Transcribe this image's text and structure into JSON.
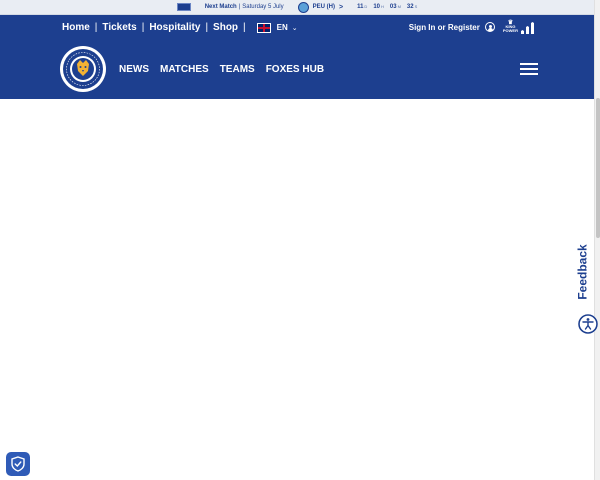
{
  "match_bar": {
    "label": "Next Match",
    "separator": "|",
    "date": "Saturday 5 July",
    "opponent": "PEU (H)",
    "arrow": ">",
    "countdown": [
      {
        "value": "11",
        "unit": "D"
      },
      {
        "value": "10",
        "unit": "H"
      },
      {
        "value": "03",
        "unit": "M"
      },
      {
        "value": "32",
        "unit": "S"
      }
    ]
  },
  "utility_nav": {
    "links": [
      "Home",
      "Tickets",
      "Hospitality",
      "Shop"
    ],
    "separator": "|",
    "language": "EN"
  },
  "account": {
    "signin_label": "Sign In or Register",
    "sponsor_top": "KING",
    "sponsor_bottom": "POWER"
  },
  "main_nav": {
    "items": [
      "NEWS",
      "MATCHES",
      "TEAMS",
      "FOXES HUB"
    ]
  },
  "side_widgets": {
    "feedback_label": "Feedback"
  },
  "colors": {
    "brand_blue": "#1d3f8f",
    "gold": "#f2b233"
  }
}
